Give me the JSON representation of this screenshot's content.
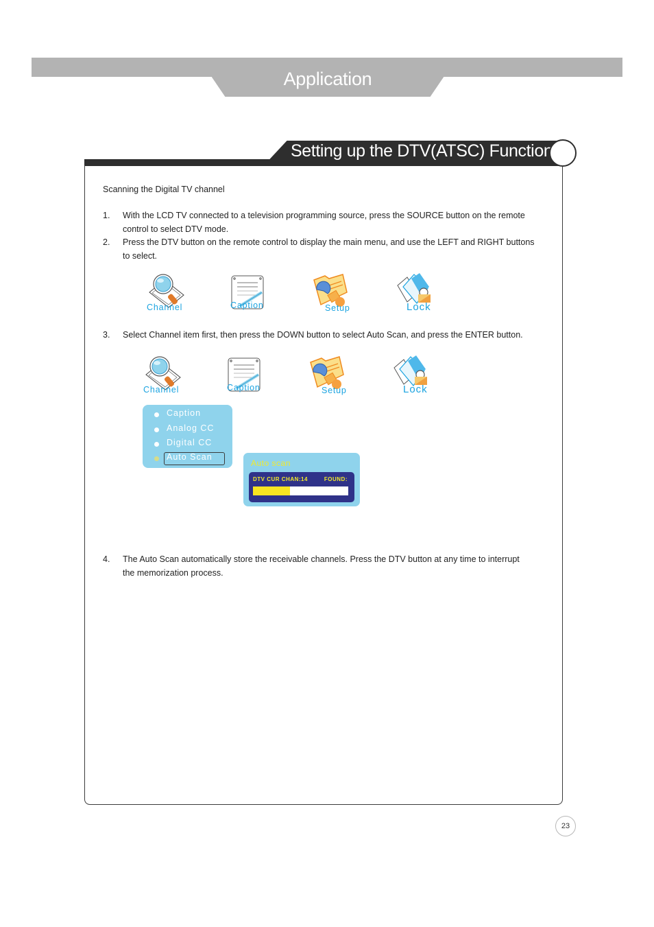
{
  "header": {
    "title": "Application"
  },
  "section": {
    "title": "Setting up the DTV(ATSC) Function"
  },
  "content": {
    "intro": "Scanning the Digital TV channel",
    "steps": [
      {
        "num": "1.",
        "line1": "With the LCD TV connected to a television programming source, press the SOURCE button on the remote",
        "line2": "control to select DTV mode."
      },
      {
        "num": "2.",
        "line1": "Press the DTV button on the remote control to display the main menu, and use the LEFT and RIGHT buttons",
        "line2": "to select."
      },
      {
        "num": "3.",
        "line1": "Select Channel item first, then press the DOWN button to select Auto Scan, and press the ENTER button.",
        "line2": ""
      },
      {
        "num": "4.",
        "line1": "The Auto Scan automatically store the receivable channels. Press the DTV button at any time to interrupt",
        "line2": "the memorization process."
      }
    ]
  },
  "menu_icons": [
    {
      "label": "Channel",
      "icon": "magnifier-icon"
    },
    {
      "label": "Caption",
      "icon": "notepad-icon"
    },
    {
      "label": "Setup",
      "icon": "folder-wrench-icon"
    },
    {
      "label": "Lock",
      "icon": "padlock-icon"
    }
  ],
  "submenu": {
    "items": [
      {
        "label": "Caption",
        "selected": false
      },
      {
        "label": "Analog CC",
        "selected": false
      },
      {
        "label": "Digital CC",
        "selected": false
      },
      {
        "label": "Auto Scan",
        "selected": true
      }
    ]
  },
  "auto_scan": {
    "title": "Auto scan",
    "channel_text": "DTV CUR CHAN:14",
    "found_text": "FOUND:",
    "progress": 0.39
  },
  "colors": {
    "icon_label": "#1aa3e0",
    "menu_bg": "#8fd3ec",
    "scan_panel": "#2f3289",
    "scan_text": "#f3ea2a",
    "progress_fill": "#f8e521"
  },
  "page_number": "23"
}
